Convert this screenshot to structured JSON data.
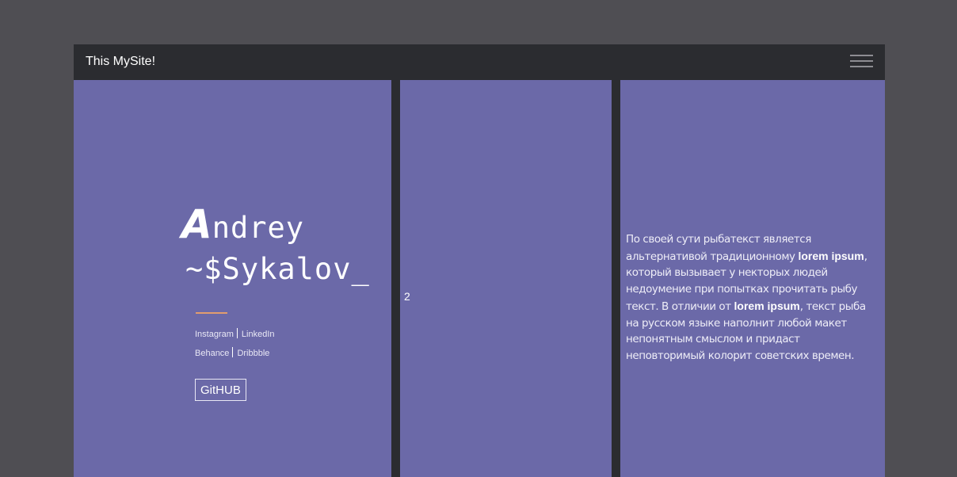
{
  "navbar": {
    "brand": "This MySite!",
    "menu_icon": "hamburger-menu-icon"
  },
  "profile": {
    "name_first_initial": "A",
    "name_first_rest": "ndrey",
    "name_last": "~$Sykalov_",
    "social": [
      {
        "label": "Instagram"
      },
      {
        "label": "LinkedIn"
      },
      {
        "label": "Behance"
      },
      {
        "label": "Dribbble"
      }
    ],
    "github_label": "GitHUB"
  },
  "middle": {
    "number": "2"
  },
  "text_panel": {
    "p1": "По своей сути рыбатекст является альтернативой традиционному ",
    "hl1": "lorem ipsum",
    "p2": ", который вызывает у некторых людей недоумение при попытках прочитать рыбу текст. В отличии от ",
    "hl2": "lorem ipsum",
    "p3": ", текст рыба на русском языке наполнит любой макет непонятным смыслом и придаст неповторимый колорит советских времен."
  },
  "colors": {
    "background": "#4f4e53",
    "navbar": "#2b2c30",
    "panel": "#6b69a8",
    "accent": "#e19c6e",
    "text": "#ffffff"
  }
}
